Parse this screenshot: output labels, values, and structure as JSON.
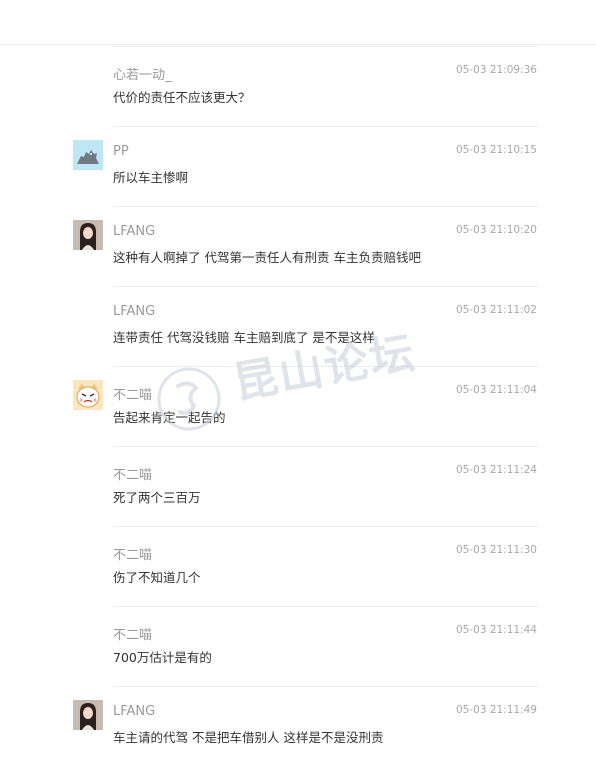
{
  "comments": [
    {
      "user": "心若一动_",
      "time": "05-03 21:09:36",
      "text": "代价的责任不应该更大？",
      "avatar": "none"
    },
    {
      "user": "PP",
      "time": "05-03 21:10:15",
      "text": "所以车主惨啊",
      "avatar": "animal-avatar"
    },
    {
      "user": "LFANG",
      "time": "05-03 21:10:20",
      "text": "这种有人啊掉了  代驾第一责任人有刑责 车主负责赔钱吧",
      "avatar": "girl-photo-avatar"
    },
    {
      "user": "LFANG",
      "time": "05-03 21:11:02",
      "text": "连带责任 代驾没钱赔 车主赔到底了 是不是这样",
      "avatar": "none"
    },
    {
      "user": "不二喵",
      "time": "05-03 21:11:04",
      "text": "告起来肯定一起告的",
      "avatar": "cartoon-cat-avatar"
    },
    {
      "user": "不二喵",
      "time": "05-03 21:11:24",
      "text": "死了两个三百万",
      "avatar": "none"
    },
    {
      "user": "不二喵",
      "time": "05-03 21:11:30",
      "text": "伤了不知道几个",
      "avatar": "none"
    },
    {
      "user": "不二喵",
      "time": "05-03 21:11:44",
      "text": "700万估计是有的",
      "avatar": "none"
    },
    {
      "user": "LFANG",
      "time": "05-03 21:11:49",
      "text": "车主请的代驾 不是把车借别人 这样是不是没刑责",
      "avatar": "girl-photo-avatar"
    }
  ],
  "watermark": {
    "text": "昆山论坛"
  },
  "colors": {
    "username": "#9a9a9a",
    "time": "#a8a8a8",
    "text": "#333333",
    "divider": "#ececec"
  }
}
